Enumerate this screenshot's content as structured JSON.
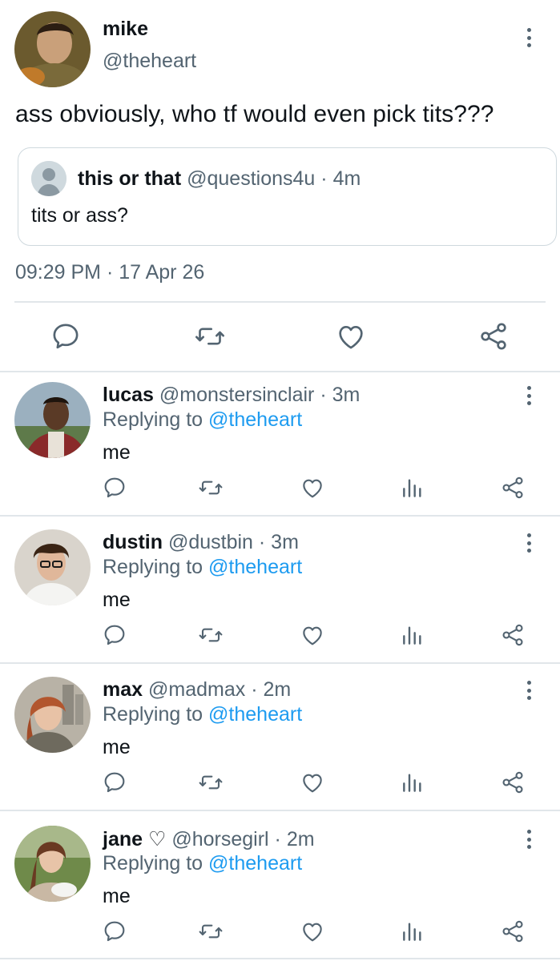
{
  "colors": {
    "text": "#0f1419",
    "muted": "#536471",
    "link": "#1d9bf0",
    "border": "#cfd9de",
    "divider": "#e1e6ea"
  },
  "main_tweet": {
    "name": "mike",
    "handle": "@theheart",
    "text": "ass obviously, who tf would even pick tits???",
    "quote": {
      "name": "this or that",
      "handle": "@questions4u",
      "time": "4m",
      "text": "tits or ass?"
    },
    "timestamp": "09:29 PM · 17 Apr 26",
    "icons": [
      "reply-icon",
      "retweet-icon",
      "like-icon",
      "share-icon"
    ]
  },
  "replies": [
    {
      "name": "lucas",
      "handle": "@monstersinclair",
      "time": "3m",
      "replying_prefix": "Replying to",
      "replying_to": "@theheart",
      "text": "me"
    },
    {
      "name": "dustin",
      "handle": "@dustbin",
      "time": "3m",
      "replying_prefix": "Replying to",
      "replying_to": "@theheart",
      "text": "me"
    },
    {
      "name": "max",
      "handle": "@madmax",
      "time": "2m",
      "replying_prefix": "Replying to",
      "replying_to": "@theheart",
      "text": "me"
    },
    {
      "name": "jane ♡",
      "handle": "@horsegirl",
      "time": "2m",
      "replying_prefix": "Replying to",
      "replying_to": "@theheart",
      "text": "me"
    }
  ],
  "reply_icons": [
    "reply-icon",
    "retweet-icon",
    "like-icon",
    "views-icon",
    "share-icon"
  ],
  "separator": " · "
}
